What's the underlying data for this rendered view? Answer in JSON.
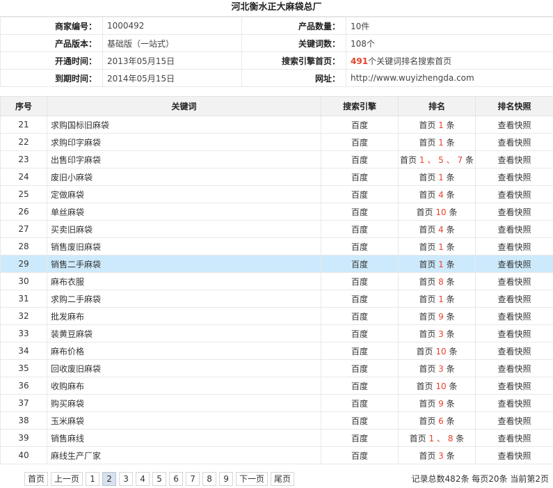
{
  "header": {
    "title": "河北衡水正大麻袋总厂"
  },
  "info": {
    "merchant_no_label": "商家编号：",
    "merchant_no": "1000492",
    "product_count_label": "产品数量：",
    "product_count": "10件",
    "product_version_label": "产品版本：",
    "product_version": "基础版（一站式）",
    "keyword_count_label": "关键词数：",
    "keyword_count": "108个",
    "open_date_label": "开通时间：",
    "open_date": "2013年05月15日",
    "search_home_label": "搜索引擎首页：",
    "search_home_count": "491",
    "search_home_text": "个关键词排名搜索首页",
    "expire_date_label": "到期时间：",
    "expire_date": "2014年05月15日",
    "website_label": "网址：",
    "website": "http://www.wuyizhengda.com"
  },
  "table": {
    "headers": {
      "no": "序号",
      "keyword": "关键词",
      "engine": "搜索引擎",
      "rank": "排名",
      "snapshot": "排名快照"
    },
    "rank_prefix": "首页",
    "rank_suffix": "条",
    "rank_sep": "、",
    "highlight_row_index": 8,
    "rows": [
      {
        "no": "21",
        "keyword": "求购国标旧麻袋",
        "engine": "百度",
        "ranks": [
          "1"
        ],
        "snapshot": "查看快照"
      },
      {
        "no": "22",
        "keyword": "求购印字麻袋",
        "engine": "百度",
        "ranks": [
          "1"
        ],
        "snapshot": "查看快照"
      },
      {
        "no": "23",
        "keyword": "出售印字麻袋",
        "engine": "百度",
        "ranks": [
          "1",
          "5",
          "7"
        ],
        "snapshot": "查看快照"
      },
      {
        "no": "24",
        "keyword": "废旧小麻袋",
        "engine": "百度",
        "ranks": [
          "1"
        ],
        "snapshot": "查看快照"
      },
      {
        "no": "25",
        "keyword": "定做麻袋",
        "engine": "百度",
        "ranks": [
          "4"
        ],
        "snapshot": "查看快照"
      },
      {
        "no": "26",
        "keyword": "单丝麻袋",
        "engine": "百度",
        "ranks": [
          "10"
        ],
        "snapshot": "查看快照"
      },
      {
        "no": "27",
        "keyword": "买卖旧麻袋",
        "engine": "百度",
        "ranks": [
          "4"
        ],
        "snapshot": "查看快照"
      },
      {
        "no": "28",
        "keyword": "销售废旧麻袋",
        "engine": "百度",
        "ranks": [
          "1"
        ],
        "snapshot": "查看快照"
      },
      {
        "no": "29",
        "keyword": "销售二手麻袋",
        "engine": "百度",
        "ranks": [
          "1"
        ],
        "snapshot": "查看快照"
      },
      {
        "no": "30",
        "keyword": "麻布衣服",
        "engine": "百度",
        "ranks": [
          "8"
        ],
        "snapshot": "查看快照"
      },
      {
        "no": "31",
        "keyword": "求购二手麻袋",
        "engine": "百度",
        "ranks": [
          "1"
        ],
        "snapshot": "查看快照"
      },
      {
        "no": "32",
        "keyword": "批发麻布",
        "engine": "百度",
        "ranks": [
          "9"
        ],
        "snapshot": "查看快照"
      },
      {
        "no": "33",
        "keyword": "装黄豆麻袋",
        "engine": "百度",
        "ranks": [
          "3"
        ],
        "snapshot": "查看快照"
      },
      {
        "no": "34",
        "keyword": "麻布价格",
        "engine": "百度",
        "ranks": [
          "10"
        ],
        "snapshot": "查看快照"
      },
      {
        "no": "35",
        "keyword": "回收废旧麻袋",
        "engine": "百度",
        "ranks": [
          "3"
        ],
        "snapshot": "查看快照"
      },
      {
        "no": "36",
        "keyword": "收购麻布",
        "engine": "百度",
        "ranks": [
          "10"
        ],
        "snapshot": "查看快照"
      },
      {
        "no": "37",
        "keyword": "购买麻袋",
        "engine": "百度",
        "ranks": [
          "9"
        ],
        "snapshot": "查看快照"
      },
      {
        "no": "38",
        "keyword": "玉米麻袋",
        "engine": "百度",
        "ranks": [
          "6"
        ],
        "snapshot": "查看快照"
      },
      {
        "no": "39",
        "keyword": "销售麻线",
        "engine": "百度",
        "ranks": [
          "1",
          "8"
        ],
        "snapshot": "查看快照"
      },
      {
        "no": "40",
        "keyword": "麻线生产厂家",
        "engine": "百度",
        "ranks": [
          "3"
        ],
        "snapshot": "查看快照"
      }
    ]
  },
  "pager": {
    "first": "首页",
    "prev": "上一页",
    "next": "下一页",
    "last": "尾页",
    "pages": [
      "1",
      "2",
      "3",
      "4",
      "5",
      "6",
      "7",
      "8",
      "9"
    ],
    "current": "2",
    "summary": "记录总数482条 每页20条 当前第2页"
  },
  "colors": {
    "accent_red": "#e8412c",
    "highlight_row": "#cdeafc",
    "header_bg": "#f2f2f2"
  }
}
